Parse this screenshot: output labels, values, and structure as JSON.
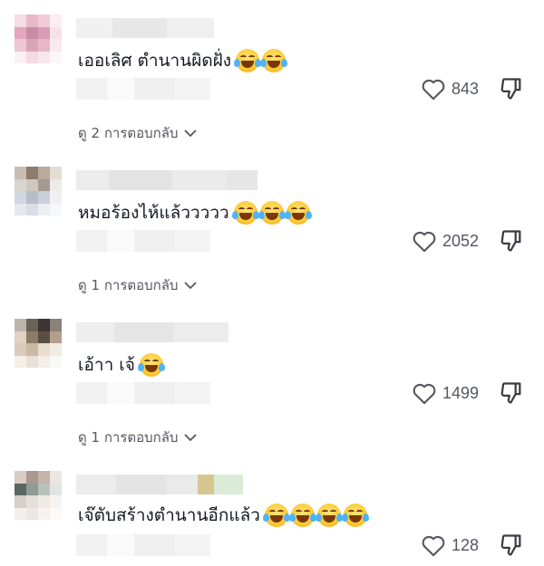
{
  "comments": [
    {
      "text": "เออเลิศ ตำนานผิดฝั่ง",
      "emoji_count": 2,
      "emoji": "face-with-tears-of-joy-icon",
      "likes": "843",
      "replies_label": "ดู 2 การตอบกลับ",
      "avatar_colors": [
        "#f4dde3",
        "#e9b9c9",
        "#f2cbd6",
        "#fbeef1",
        "#e3a6bd",
        "#c98ca6",
        "#d99cb4",
        "#f6e1e8",
        "#efc7d4",
        "#dba4b9",
        "#e8b8c8",
        "#f9e8ee",
        "#fbf1f4",
        "#f5dae3",
        "#f8e6ec",
        "#fdf6f8"
      ]
    },
    {
      "text": "หมอร้องไห้แล้ววววว",
      "emoji_count": 3,
      "emoji": "face-with-tears-of-joy-icon",
      "likes": "2052",
      "replies_label": "ดู 1 การตอบกลับ",
      "avatar_colors": [
        "#c9bdb3",
        "#8d7c6c",
        "#b8aa9c",
        "#e3dcd4",
        "#d9d4cf",
        "#cfc7be",
        "#a59a8f",
        "#ecebea",
        "#d2d6e0",
        "#b7bdcc",
        "#c9ced9",
        "#eef0f4",
        "#e6e8ee",
        "#dadde6",
        "#eceef2",
        "#f6f7f9"
      ]
    },
    {
      "text": "เอ้าา เจ้",
      "emoji_count": 1,
      "emoji": "face-with-tears-of-joy-icon",
      "likes": "1499",
      "replies_label": "ดู 1 การตอบกลับ",
      "avatar_colors": [
        "#bdb5ad",
        "#6b625a",
        "#3b3632",
        "#8a8179",
        "#e0d2c2",
        "#8e7b68",
        "#5a4e43",
        "#b39f8c",
        "#d9cabb",
        "#cbb8a3",
        "#e8dccf",
        "#f2ebe3",
        "#f4efe9",
        "#e9e1d8",
        "#f3eee8",
        "#faf8f5"
      ]
    },
    {
      "text": "เจ๊ตับสร้างตำนานอีกแล้ว",
      "emoji_count": 4,
      "emoji": "face-with-tears-of-joy-icon",
      "likes": "128",
      "replies_label": "",
      "avatar_colors": [
        "#d8ccc6",
        "#a9988f",
        "#c4b4ac",
        "#ece6e2",
        "#5c6660",
        "#8e9a92",
        "#b9c1bc",
        "#e1e5e2",
        "#d6cfc9",
        "#e6dfd9",
        "#efeae6",
        "#f6f3f1",
        "#f1eeec",
        "#ece7e4",
        "#f5f2f0",
        "#fbfaf9"
      ]
    }
  ],
  "colors": {
    "text": "#161823",
    "muted": "#555760"
  }
}
